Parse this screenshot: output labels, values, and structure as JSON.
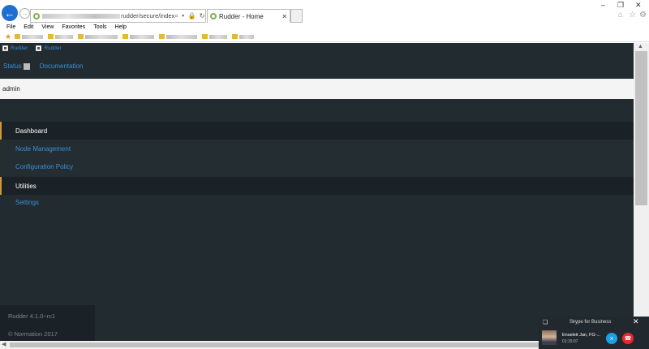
{
  "browser": {
    "address_text": "rudder/secure/index",
    "address_icons": "⌕ ▾ 🔒 ↻",
    "tab_title": "Rudder - Home",
    "tab_close": "✕",
    "window_controls": [
      "–",
      "❐",
      "✕"
    ],
    "right_icons": [
      "⌂",
      "☆",
      "⚙"
    ]
  },
  "menu_bar": [
    "File",
    "Edit",
    "View",
    "Favorites",
    "Tools",
    "Help"
  ],
  "page": {
    "image_links": [
      "Rudder",
      "Rudder"
    ],
    "status_link": "Status",
    "documentation_link": "Documentation",
    "user": "admin",
    "nav": [
      {
        "label": "Dashboard",
        "state": "active"
      },
      {
        "label": "Node Management",
        "state": "link"
      },
      {
        "label": "Configuration Policy",
        "state": "link"
      },
      {
        "label": "Utilities",
        "state": "active"
      },
      {
        "label": "Settings",
        "state": "link"
      }
    ],
    "version": "Rudder 4.1.0~rc1",
    "copyright": "© Normation 2017"
  },
  "skype": {
    "title": "Skype for Business",
    "caller": "Enseleit Jan, FG-...",
    "duration": "01:15:07",
    "close": "✕"
  },
  "colors": {
    "page_bg": "#222b30",
    "link": "#3a8fd6",
    "active_accent": "#d09a3b",
    "back_button": "#1f6fd0"
  }
}
